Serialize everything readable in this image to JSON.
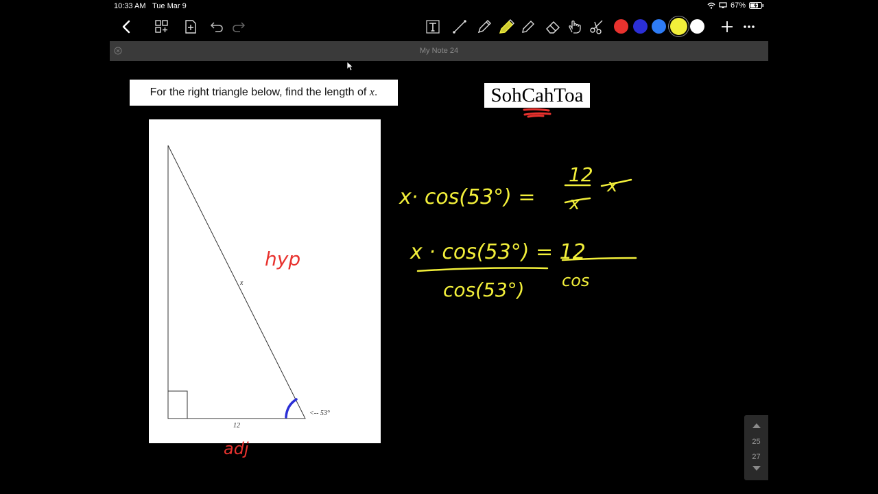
{
  "status": {
    "time": "10:33 AM",
    "date": "Tue Mar 9",
    "battery": "67%"
  },
  "toolbar": {
    "colors": [
      "#e8322e",
      "#2b2fd6",
      "#2e7cf6",
      "#f2ef3a",
      "#ffffff"
    ],
    "selected_color": "#f2ef3a",
    "selected_tool": "highlighter"
  },
  "document": {
    "title": "My Note 24"
  },
  "page": {
    "question_prefix": "For the right triangle below, find the length of ",
    "question_var": "x",
    "question_suffix": ".",
    "mnemonic": "SohCahToa",
    "figure": {
      "side_label_hyp": "x",
      "side_label_adj": "12",
      "angle_label": "<-- 53°"
    },
    "annotations": {
      "hyp": "hyp",
      "adj": "adj",
      "line1_left": "x· cos(53°) = ",
      "line1_num": "12",
      "line1_den": "x",
      "line1_right": "x",
      "line2_num_left": "x · cos(53°) = 12",
      "line2_den_left": "cos(53°)",
      "line2_den_right": "cos"
    }
  },
  "pager": {
    "current": "25",
    "next": "27"
  }
}
